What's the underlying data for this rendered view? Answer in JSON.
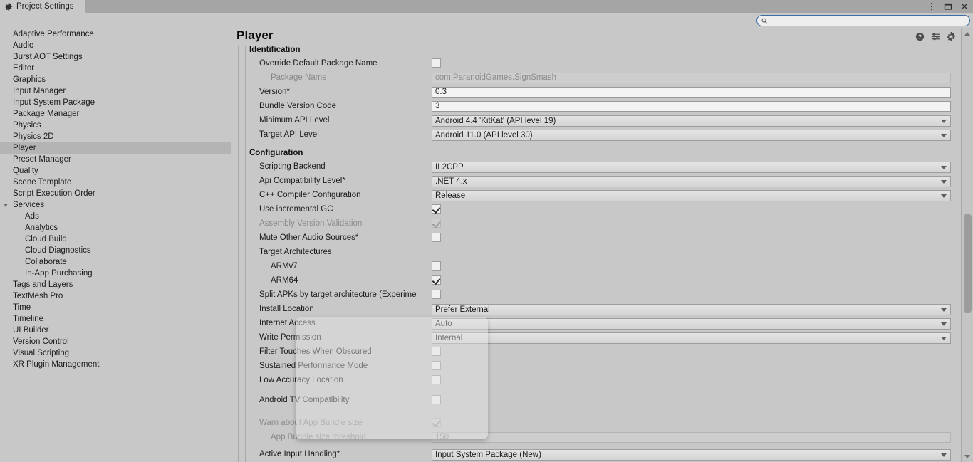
{
  "window": {
    "tab_label": "Project Settings",
    "tab_icon": "gear-icon",
    "controls": [
      {
        "name": "window-menu-button",
        "icon": "kebab-menu-icon"
      },
      {
        "name": "window-maximize-button",
        "icon": "maximize-icon"
      },
      {
        "name": "window-close-button",
        "icon": "close-icon"
      }
    ]
  },
  "search": {
    "value": "",
    "placeholder": "",
    "icon": "search-icon"
  },
  "sidebar": {
    "items": [
      {
        "label": "Adaptive Performance",
        "level": 0,
        "selected": false
      },
      {
        "label": "Audio",
        "level": 0,
        "selected": false
      },
      {
        "label": "Burst AOT Settings",
        "level": 0,
        "selected": false
      },
      {
        "label": "Editor",
        "level": 0,
        "selected": false
      },
      {
        "label": "Graphics",
        "level": 0,
        "selected": false
      },
      {
        "label": "Input Manager",
        "level": 0,
        "selected": false
      },
      {
        "label": "Input System Package",
        "level": 0,
        "selected": false
      },
      {
        "label": "Package Manager",
        "level": 0,
        "selected": false
      },
      {
        "label": "Physics",
        "level": 0,
        "selected": false
      },
      {
        "label": "Physics 2D",
        "level": 0,
        "selected": false
      },
      {
        "label": "Player",
        "level": 0,
        "selected": true
      },
      {
        "label": "Preset Manager",
        "level": 0,
        "selected": false
      },
      {
        "label": "Quality",
        "level": 0,
        "selected": false
      },
      {
        "label": "Scene Template",
        "level": 0,
        "selected": false
      },
      {
        "label": "Script Execution Order",
        "level": 0,
        "selected": false
      },
      {
        "label": "Services",
        "level": 0,
        "selected": false,
        "expanded": true
      },
      {
        "label": "Ads",
        "level": 1,
        "selected": false
      },
      {
        "label": "Analytics",
        "level": 1,
        "selected": false
      },
      {
        "label": "Cloud Build",
        "level": 1,
        "selected": false
      },
      {
        "label": "Cloud Diagnostics",
        "level": 1,
        "selected": false
      },
      {
        "label": "Collaborate",
        "level": 1,
        "selected": false
      },
      {
        "label": "In-App Purchasing",
        "level": 1,
        "selected": false
      },
      {
        "label": "Tags and Layers",
        "level": 0,
        "selected": false
      },
      {
        "label": "TextMesh Pro",
        "level": 0,
        "selected": false
      },
      {
        "label": "Time",
        "level": 0,
        "selected": false
      },
      {
        "label": "Timeline",
        "level": 0,
        "selected": false
      },
      {
        "label": "UI Builder",
        "level": 0,
        "selected": false
      },
      {
        "label": "Version Control",
        "level": 0,
        "selected": false
      },
      {
        "label": "Visual Scripting",
        "level": 0,
        "selected": false
      },
      {
        "label": "XR Plugin Management",
        "level": 0,
        "selected": false
      }
    ]
  },
  "panel": {
    "title": "Player",
    "header_icons": [
      {
        "name": "help-icon",
        "label": "?"
      },
      {
        "name": "preset-icon",
        "label": ""
      },
      {
        "name": "gear-icon",
        "label": ""
      }
    ],
    "sections": [
      {
        "title": "Identification"
      },
      {
        "title": "Configuration"
      }
    ],
    "rows": [
      {
        "label": "Override Default Package Name",
        "type": "checkbox",
        "checked": false,
        "disabled": false,
        "indent": 1
      },
      {
        "label": "Package Name",
        "type": "text",
        "value": "com.ParanoidGames.SignSmash",
        "disabled": true,
        "indent": 2
      },
      {
        "label": "Version*",
        "type": "text",
        "value": "0.3",
        "disabled": false,
        "editable": true,
        "indent": 1
      },
      {
        "label": "Bundle Version Code",
        "type": "text",
        "value": "3",
        "disabled": false,
        "editable": true,
        "indent": 1
      },
      {
        "label": "Minimum API Level",
        "type": "dropdown",
        "value": "Android 4.4 'KitKat' (API level 19)",
        "indent": 1
      },
      {
        "label": "Target API Level",
        "type": "dropdown",
        "value": "Android 11.0 (API level 30)",
        "indent": 1
      },
      {
        "label": "Scripting Backend",
        "type": "dropdown",
        "value": "IL2CPP",
        "indent": 1
      },
      {
        "label": "Api Compatibility Level*",
        "type": "dropdown",
        "value": ".NET 4.x",
        "indent": 1
      },
      {
        "label": "C++ Compiler Configuration",
        "type": "dropdown",
        "value": "Release",
        "indent": 1
      },
      {
        "label": "Use incremental GC",
        "type": "checkbox",
        "checked": true,
        "disabled": false,
        "indent": 1
      },
      {
        "label": "Assembly Version Validation",
        "type": "checkbox",
        "checked": true,
        "disabled": true,
        "indent": 1
      },
      {
        "label": "Mute Other Audio Sources*",
        "type": "checkbox",
        "checked": false,
        "disabled": false,
        "indent": 1
      },
      {
        "label": "Target Architectures",
        "type": "none",
        "indent": 1
      },
      {
        "label": "ARMv7",
        "type": "checkbox",
        "checked": false,
        "disabled": false,
        "indent": 2
      },
      {
        "label": "ARM64",
        "type": "checkbox",
        "checked": true,
        "disabled": false,
        "indent": 2
      },
      {
        "label": "Split APKs by target architecture (Experime",
        "type": "checkbox",
        "checked": false,
        "disabled": false,
        "indent": 1
      },
      {
        "label": "Install Location",
        "type": "dropdown",
        "value": "Prefer External",
        "indent": 1
      },
      {
        "label": "Internet Access",
        "type": "dropdown",
        "value": "Auto",
        "indent": 1
      },
      {
        "label": "Write Permission",
        "type": "dropdown",
        "value": "Internal",
        "indent": 1
      },
      {
        "label": "Filter Touches When Obscured",
        "type": "checkbox",
        "checked": false,
        "disabled": false,
        "indent": 1
      },
      {
        "label": "Sustained Performance Mode",
        "type": "checkbox",
        "checked": false,
        "disabled": false,
        "indent": 1
      },
      {
        "label": "Low Accuracy Location",
        "type": "checkbox",
        "checked": false,
        "disabled": false,
        "indent": 1
      },
      {
        "label": "Android TV Compatibility",
        "type": "checkbox",
        "checked": false,
        "disabled": false,
        "indent": 1
      },
      {
        "label": "Warn about App Bundle size",
        "type": "checkbox",
        "checked": true,
        "disabled": true,
        "indent": 1
      },
      {
        "label": "App Bundle size threshold",
        "type": "text",
        "value": "150",
        "disabled": true,
        "indent": 2
      },
      {
        "label": "Active Input Handling*",
        "type": "dropdown",
        "value": "Input System Package (New)",
        "indent": 1
      }
    ]
  },
  "colors": {
    "background": "#c8c8c8",
    "titlebar": "#a5a5a5",
    "selected_row": "#b4b4b4",
    "search_focus_border": "#3a6ea5",
    "scroll_thumb": "#9c9c9c"
  }
}
